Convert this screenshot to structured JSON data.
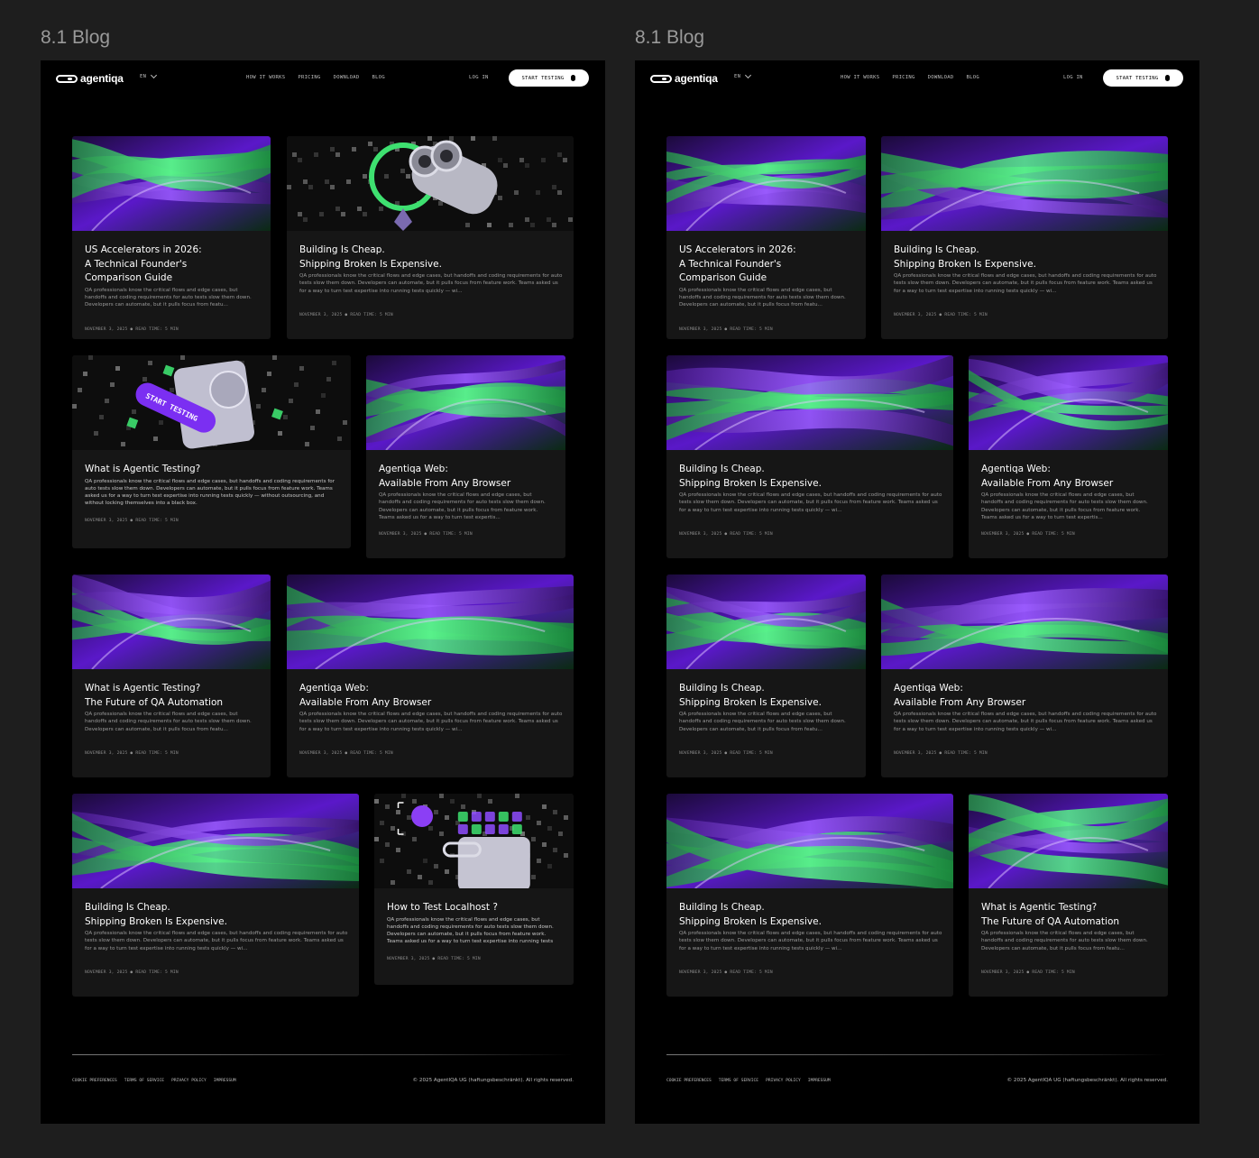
{
  "frames": [
    {
      "label": "8.1 Blog",
      "nav": {
        "logo": "agentiqa",
        "lang": "EN",
        "links": [
          "HOW IT WORKS",
          "PRICING",
          "DOWNLOAD",
          "BLOG"
        ],
        "login": "LOG IN",
        "cta": "START TESTING"
      },
      "cards": [
        {
          "title_lines": [
            "US Accelerators in 2026:",
            "A Technical Founder's",
            "Comparison Guide"
          ],
          "text": "QA professionals know the critical flows and edge cases, but handoffs and coding requirements for auto tests slow them down. Developers can automate, but it pulls focus from featu...",
          "meta": "NOVEMBER 3, 2025 ● READ TIME: 5 MIN",
          "image": "abstract-green-purple-art"
        },
        {
          "title_lines": [
            "Building Is Cheap.",
            "Shipping Broken Is Expensive."
          ],
          "text": "QA professionals know the critical flows and edge cases, but handoffs and coding requirements for auto tests slow them down. Developers can automate, but it pulls focus from feature work. Teams asked us for a way to turn test expertise into running tests quickly — wi...",
          "meta": "NOVEMBER 3, 2025 ● READ TIME: 5 MIN",
          "image": "binoculars-illustration"
        },
        {
          "title_lines": [
            "What is Agentic Testing?"
          ],
          "text": "QA professionals know the critical flows and edge cases, but handoffs and coding requirements for auto tests slow them down. Developers can automate, but it pulls focus from feature work. Teams asked us for a way to turn test expertise into running tests quickly — without outsourcing, and without locking themselves into a black box.",
          "meta": "NOVEMBER 3, 2025 ● READ TIME: 5 MIN",
          "image": "start-testing-illustration",
          "image_text": "START TESTING",
          "light_text": true
        },
        {
          "title_lines": [
            "Agentiqa Web:",
            "Available From Any Browser"
          ],
          "text": "QA professionals know the critical flows and edge cases, but handoffs and coding requirements for auto tests slow them down. Developers can automate, but it pulls focus from feature work. Teams asked us for a way to turn test expertis...",
          "meta": "NOVEMBER 3, 2025 ● READ TIME: 5 MIN",
          "image": "abstract-green-purple-art"
        },
        {
          "title_lines": [
            "What is Agentic Testing?",
            "The Future of QA Automation"
          ],
          "text": "QA professionals know the critical flows and edge cases, but handoffs and coding requirements for auto tests slow them down. Developers can automate, but it pulls focus from featu...",
          "meta": "NOVEMBER 3, 2025 ● READ TIME: 5 MIN",
          "image": "abstract-green-purple-art"
        },
        {
          "title_lines": [
            "Agentiqa Web:",
            "Available From Any Browser"
          ],
          "text": "QA professionals know the critical flows and edge cases, but handoffs and coding requirements for auto tests slow them down. Developers can automate, but it pulls focus from feature work. Teams asked us for a way to turn test expertise into running tests quickly — wi...",
          "meta": "NOVEMBER 3, 2025 ● READ TIME: 5 MIN",
          "image": "abstract-green-purple-art"
        },
        {
          "title_lines": [
            "Building Is Cheap.",
            "Shipping Broken Is Expensive."
          ],
          "text": "QA professionals know the critical flows and edge cases, but handoffs and coding requirements for auto tests slow them down. Developers can automate, but it pulls focus from feature work. Teams asked us for a way to turn test expertise into running tests quickly — wi...",
          "meta": "NOVEMBER 3, 2025 ● READ TIME: 5 MIN",
          "image": "abstract-green-purple-art"
        },
        {
          "title_lines": [
            "How to Test Localhost ?"
          ],
          "text": "QA professionals know the critical flows and edge cases, but handoffs and coding requirements for auto tests slow them down. Developers can automate, but it pulls focus from feature work. Teams asked us for a way to turn test expertise into running tests quickly — without outsourcing, and withou...",
          "meta": "NOVEMBER 3, 2025 ● READ TIME: 5 MIN",
          "image": "localhost-illustration",
          "light_text": true
        }
      ],
      "footer": {
        "links": [
          "COOKIE PREFERENCES",
          "TERMS OF SERVICE",
          "PRIVACY POLICY",
          "IMPRESSUM"
        ],
        "copyright": "© 2025 AgentIQA UG (haftungsbeschränkt). All rights reserved."
      }
    },
    {
      "label": "8.1 Blog",
      "nav": {
        "logo": "agentiqa",
        "lang": "EN",
        "links": [
          "HOW IT WORKS",
          "PRICING",
          "DOWNLOAD",
          "BLOG"
        ],
        "login": "LOG IN",
        "cta": "START TESTING"
      },
      "cards": [
        {
          "title_lines": [
            "US Accelerators in 2026:",
            "A Technical Founder's",
            "Comparison Guide"
          ],
          "text": "QA professionals know the critical flows and edge cases, but handoffs and coding requirements for auto tests slow them down. Developers can automate, but it pulls focus from featu...",
          "meta": "NOVEMBER 3, 2025 ● READ TIME: 5 MIN",
          "image": "abstract-green-purple-art"
        },
        {
          "title_lines": [
            "Building Is Cheap.",
            "Shipping Broken Is Expensive."
          ],
          "text": "QA professionals know the critical flows and edge cases, but handoffs and coding requirements for auto tests slow them down. Developers can automate, but it pulls focus from feature work. Teams asked us for a way to turn test expertise into running tests quickly — wi...",
          "meta": "NOVEMBER 3, 2025 ● READ TIME: 5 MIN",
          "image": "abstract-green-purple-art"
        },
        {
          "title_lines": [
            "Building Is Cheap.",
            "Shipping Broken Is Expensive."
          ],
          "text": "QA professionals know the critical flows and edge cases, but handoffs and coding requirements for auto tests slow them down. Developers can automate, but it pulls focus from feature work. Teams asked us for a way to turn test expertise into running tests quickly — wi...",
          "meta": "NOVEMBER 3, 2025 ● READ TIME: 5 MIN",
          "image": "abstract-green-purple-art"
        },
        {
          "title_lines": [
            "Agentiqa Web:",
            "Available From Any Browser"
          ],
          "text": "QA professionals know the critical flows and edge cases, but handoffs and coding requirements for auto tests slow them down. Developers can automate, but it pulls focus from feature work. Teams asked us for a way to turn test expertis...",
          "meta": "NOVEMBER 3, 2025 ● READ TIME: 5 MIN",
          "image": "abstract-green-purple-art"
        },
        {
          "title_lines": [
            "Building Is Cheap.",
            "Shipping Broken Is Expensive."
          ],
          "text": "QA professionals know the critical flows and edge cases, but handoffs and coding requirements for auto tests slow them down. Developers can automate, but it pulls focus from featu...",
          "meta": "NOVEMBER 3, 2025 ● READ TIME: 5 MIN",
          "image": "abstract-green-purple-art"
        },
        {
          "title_lines": [
            "Agentiqa Web:",
            "Available From Any Browser"
          ],
          "text": "QA professionals know the critical flows and edge cases, but handoffs and coding requirements for auto tests slow them down. Developers can automate, but it pulls focus from feature work. Teams asked us for a way to turn test expertise into running tests quickly — wi...",
          "meta": "NOVEMBER 3, 2025 ● READ TIME: 5 MIN",
          "image": "abstract-green-purple-art"
        },
        {
          "title_lines": [
            "Building Is Cheap.",
            "Shipping Broken Is Expensive."
          ],
          "text": "QA professionals know the critical flows and edge cases, but handoffs and coding requirements for auto tests slow them down. Developers can automate, but it pulls focus from feature work. Teams asked us for a way to turn test expertise into running tests quickly — wi...",
          "meta": "NOVEMBER 3, 2025 ● READ TIME: 5 MIN",
          "image": "abstract-green-purple-art"
        },
        {
          "title_lines": [
            "What is Agentic Testing?",
            "The Future of QA Automation"
          ],
          "text": "QA professionals know the critical flows and edge cases, but handoffs and coding requirements for auto tests slow them down. Developers can automate, but it pulls focus from featu...",
          "meta": "NOVEMBER 3, 2025 ● READ TIME: 5 MIN",
          "image": "abstract-green-purple-art"
        }
      ],
      "footer": {
        "links": [
          "COOKIE PREFERENCES",
          "TERMS OF SERVICE",
          "PRIVACY POLICY",
          "IMPRESSUM"
        ],
        "copyright": "© 2025 AgentIQA UG (haftungsbeschränkt). All rights reserved."
      }
    }
  ],
  "colors": {
    "background": "#1e1e1e",
    "page": "#000000",
    "card": "#161616",
    "accent_green": "#35e06b",
    "accent_purple": "#6a1fd6"
  }
}
